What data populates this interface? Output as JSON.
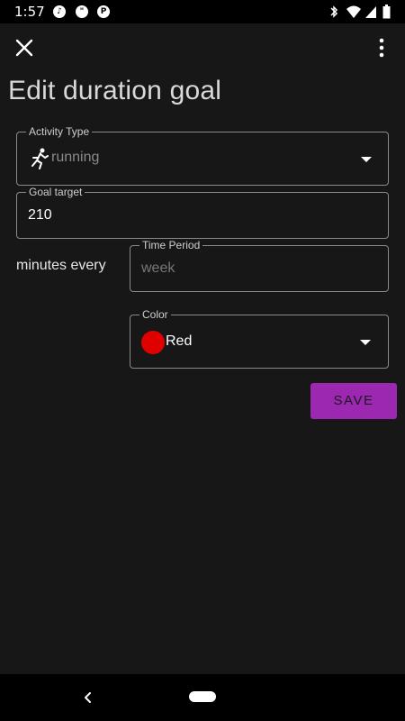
{
  "status_bar": {
    "time": "1:57"
  },
  "page": {
    "title": "Edit duration goal"
  },
  "form": {
    "activity_type": {
      "label": "Activity Type",
      "value": "running",
      "icon": "running-icon"
    },
    "goal_target": {
      "label": "Goal target",
      "value": "210"
    },
    "minutes_every_label": "minutes every",
    "time_period": {
      "label": "Time Period",
      "placeholder": "week"
    },
    "color": {
      "label": "Color",
      "value": "Red",
      "swatch": "#e00000"
    },
    "save_label": "SAVE"
  },
  "colors": {
    "background": "#171717",
    "accent": "#9c27b0",
    "outline": "#8a8a8a"
  }
}
